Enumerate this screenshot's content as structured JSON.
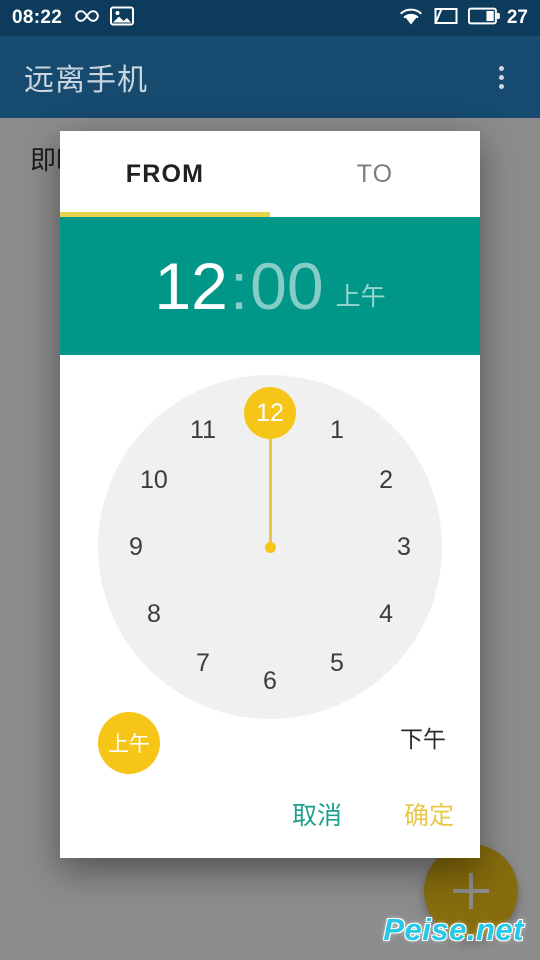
{
  "status_bar": {
    "clock": "08:22",
    "battery_level": "27",
    "icons": [
      "infinity-icon",
      "screenshot-image-icon",
      "wifi-icon",
      "sim-card-icon",
      "battery-icon"
    ]
  },
  "app_bar": {
    "title": "远离手机",
    "overflow_icon": "overflow-menu-icon"
  },
  "app_body": {
    "text": "即时"
  },
  "fab": {
    "icon": "plus-icon",
    "color": "#F5C518"
  },
  "dialog": {
    "tabs": [
      {
        "label": "FROM",
        "active": true
      },
      {
        "label": "TO",
        "active": false
      }
    ],
    "time_header": {
      "hour": "12",
      "separator": ":",
      "minute": "00",
      "meridiem": "上午",
      "background": "#009688",
      "active_field": "hour"
    },
    "clock": {
      "selected_hour": "12",
      "hours": [
        "12",
        "1",
        "2",
        "3",
        "4",
        "5",
        "6",
        "7",
        "8",
        "9",
        "10",
        "11"
      ],
      "hand_color": "#EBC741",
      "selection_color": "#F5C518",
      "face_color": "#f0f0f0"
    },
    "meridiem": {
      "am_label": "上午",
      "pm_label": "下午",
      "selected": "上午"
    },
    "actions": {
      "cancel_label": "取消",
      "ok_label": "确定",
      "cancel_color": "#1da08c",
      "ok_color": "#E9C84B"
    }
  },
  "watermark": {
    "text": "Peise.net",
    "color": "#25c8e8"
  }
}
